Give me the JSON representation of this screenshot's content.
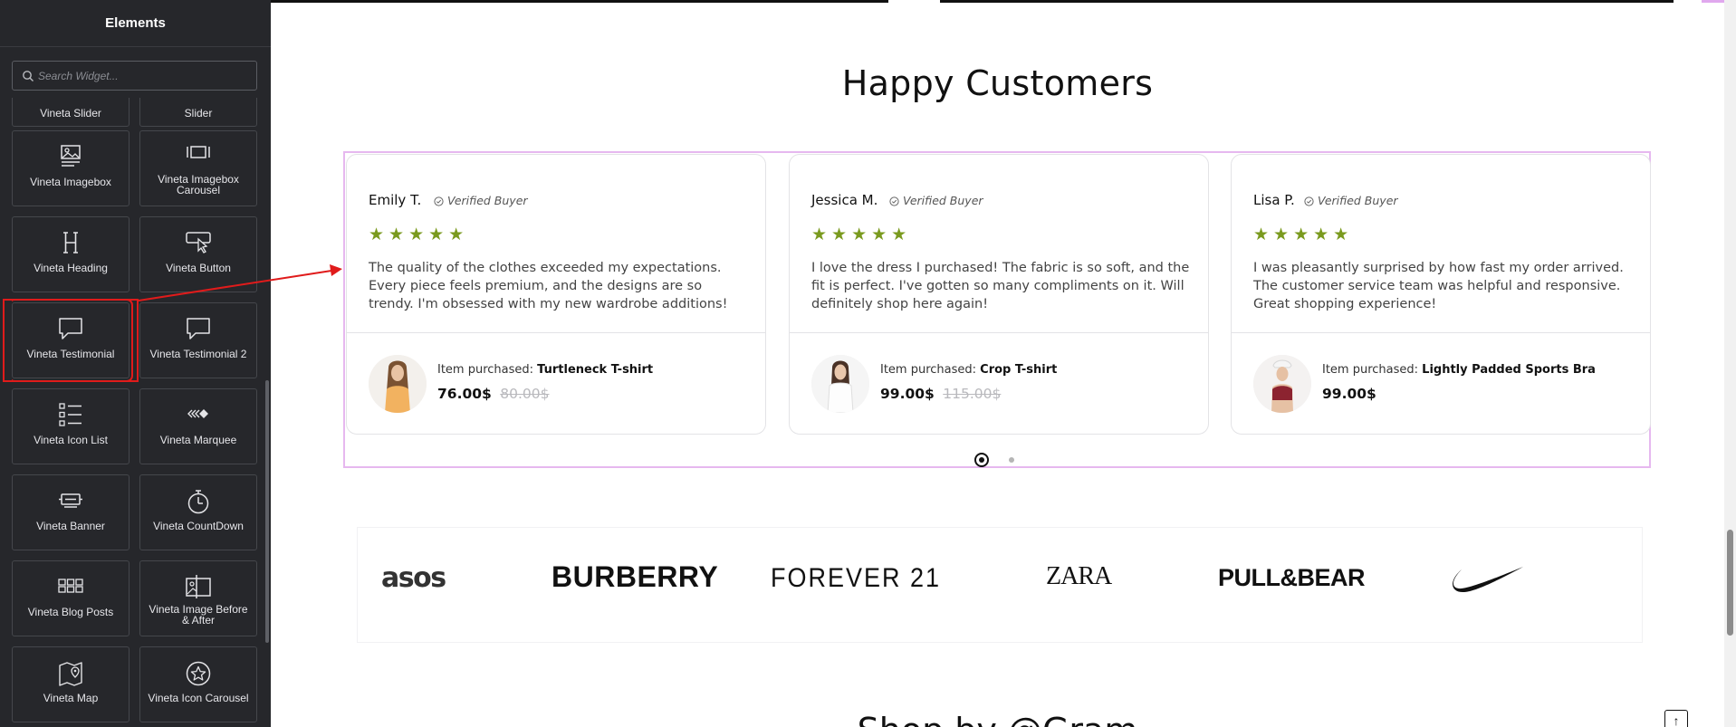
{
  "panel": {
    "title": "Elements",
    "search_placeholder": "Search Widget...",
    "widgets": [
      {
        "label": "Vineta Slider",
        "icon": "slider-icon",
        "partial": true
      },
      {
        "label": "Vineta Imagebox Slider",
        "icon": "slider-icon",
        "partial": true
      },
      {
        "label": "Vineta Imagebox",
        "icon": "image-box-icon"
      },
      {
        "label": "Vineta Imagebox Carousel",
        "icon": "image-carousel-icon"
      },
      {
        "label": "Vineta Heading",
        "icon": "heading-icon"
      },
      {
        "label": "Vineta Button",
        "icon": "button-cursor-icon"
      },
      {
        "label": "Vineta Testimonial",
        "icon": "speech-bubble-icon"
      },
      {
        "label": "Vineta Testimonial 2",
        "icon": "speech-bubble-icon"
      },
      {
        "label": "Vineta Icon List",
        "icon": "icon-list-icon"
      },
      {
        "label": "Vineta Marquee",
        "icon": "marquee-icon"
      },
      {
        "label": "Vineta Banner",
        "icon": "banner-icon"
      },
      {
        "label": "Vineta CountDown",
        "icon": "stopwatch-icon"
      },
      {
        "label": "Vineta Blog Posts",
        "icon": "grid-posts-icon"
      },
      {
        "label": "Vineta Image Before & After",
        "icon": "image-compare-icon"
      },
      {
        "label": "Vineta Map",
        "icon": "map-icon"
      },
      {
        "label": "Vineta Icon Carousel",
        "icon": "star-circle-icon"
      }
    ]
  },
  "section": {
    "heading": "Happy Customers",
    "bottom_heading": "Shop by @Gram"
  },
  "testimonials": [
    {
      "name": "Emily T.",
      "badge": "Verified Buyer",
      "stars": "★★★★★",
      "text": "The quality of the clothes exceeded my expectations. Every piece feels premium, and the designs are so trendy. I'm obsessed with my new wardrobe additions!",
      "purchased_label": "Item purchased:",
      "product": "Turtleneck T-shirt",
      "price": "76.00$",
      "old_price": "80.00$"
    },
    {
      "name": "Jessica M.",
      "badge": "Verified Buyer",
      "stars": "★★★★★",
      "text": "I love the dress I purchased! The fabric is so soft, and the fit is perfect. I've gotten so many compliments on it. Will definitely shop here again!",
      "purchased_label": "Item purchased:",
      "product": "Crop T-shirt",
      "price": "99.00$",
      "old_price": "115.00$"
    },
    {
      "name": "Lisa P.",
      "badge": "Verified Buyer",
      "stars": "★★★★★",
      "text": "I was pleasantly surprised by how fast my order arrived. The customer service team was helpful and responsive. Great shopping experience!",
      "purchased_label": "Item purchased:",
      "product": "Lightly Padded Sports Bra",
      "price": "99.00$",
      "old_price": ""
    }
  ],
  "brands": [
    "asos",
    "BURBERRY",
    "FOREVER 21",
    "ZARA",
    "PULL&BEAR",
    "nike-swoosh-logo"
  ],
  "colors": {
    "panel_bg": "#26272b",
    "star": "#7a9a1e",
    "highlight": "#e01b1b",
    "slider_outline": "#e6b8ef"
  }
}
